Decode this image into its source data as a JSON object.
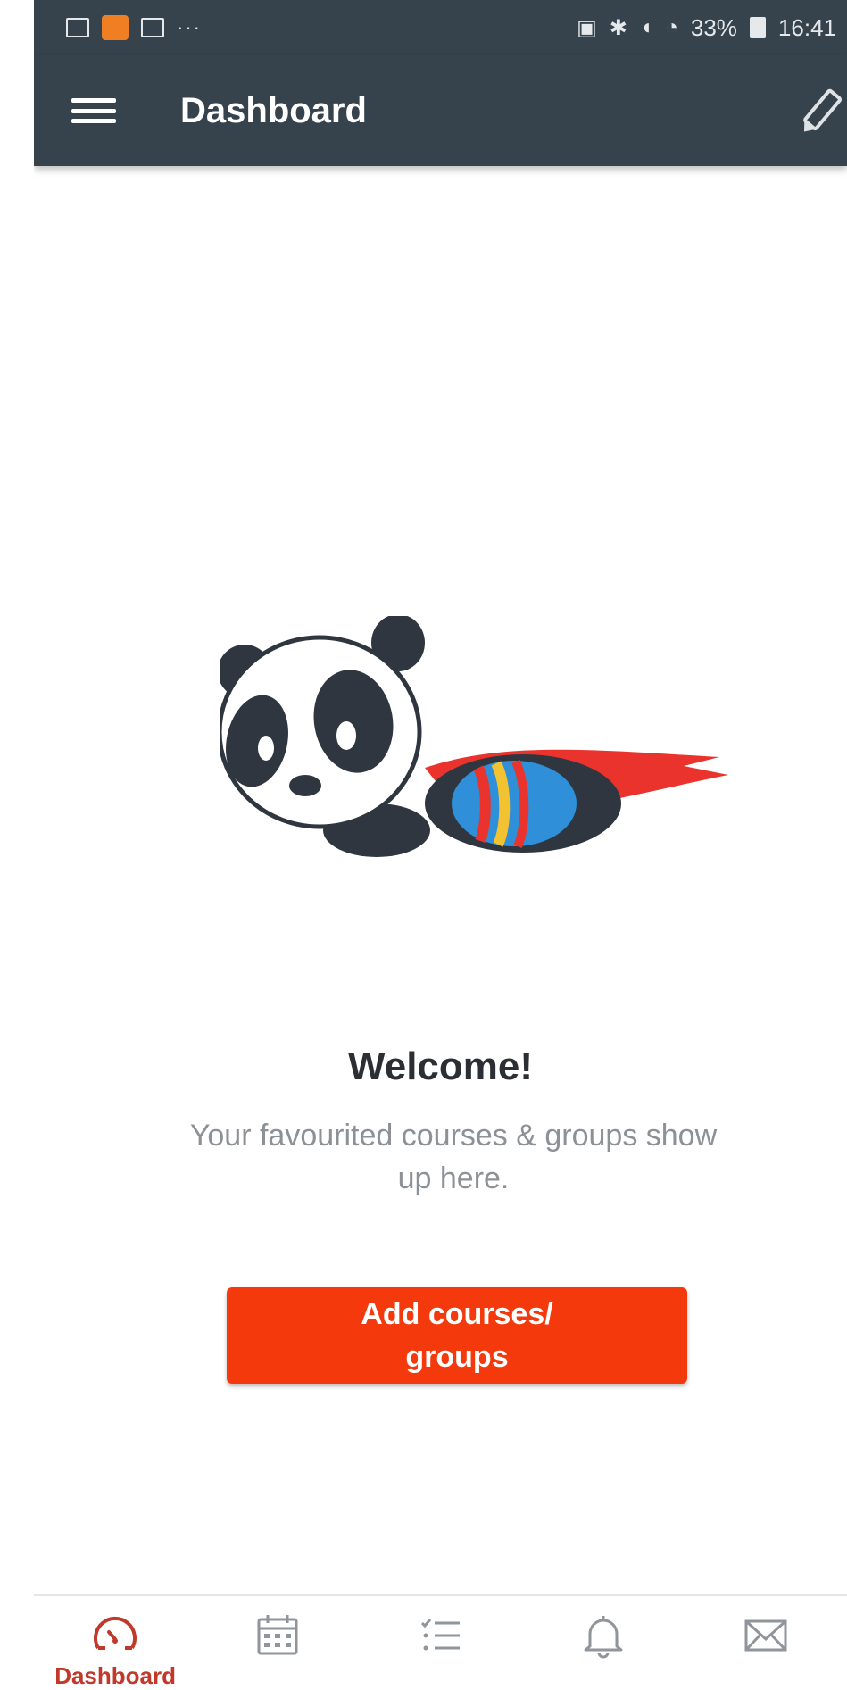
{
  "status_bar": {
    "more_indicator": "···",
    "battery_percent": "33%",
    "time": "16:41"
  },
  "app_bar": {
    "title": "Dashboard"
  },
  "empty_state": {
    "title": "Welcome!",
    "message": "Your favourited courses & groups show up here.",
    "button_label": "Add courses/ groups"
  },
  "bottom_nav": {
    "active_color": "#c0392b",
    "items": [
      {
        "icon": "dashboard-gauge-icon",
        "label": "Dashboard",
        "active": true
      },
      {
        "icon": "calendar-icon",
        "label": "",
        "active": false
      },
      {
        "icon": "todo-list-icon",
        "label": "",
        "active": false
      },
      {
        "icon": "bell-icon",
        "label": "",
        "active": false
      },
      {
        "icon": "mail-icon",
        "label": "",
        "active": false
      }
    ]
  },
  "colors": {
    "app_bar": "#36424c",
    "primary_button": "#f43a0d",
    "text_dark": "#2b2f33",
    "text_muted": "#8c9196"
  }
}
